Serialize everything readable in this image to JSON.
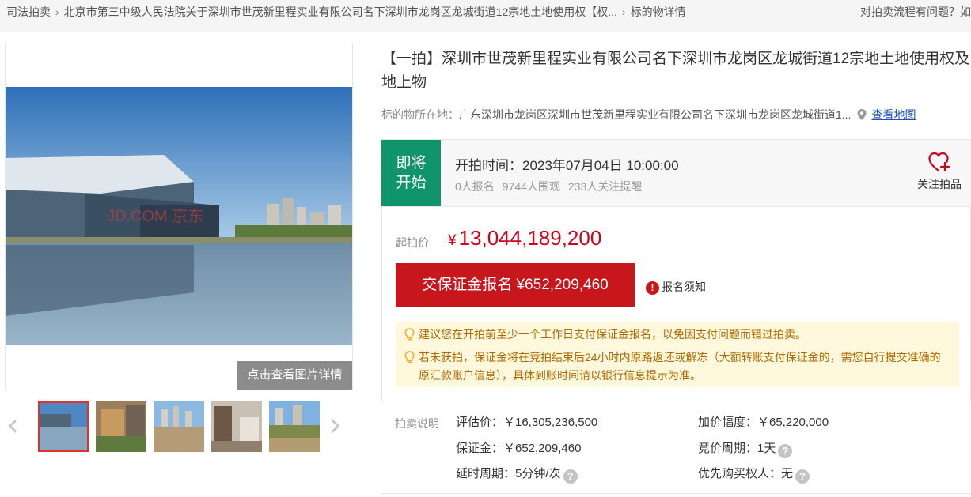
{
  "breadcrumb": {
    "items": [
      "司法拍卖",
      "北京市第三中级人民法院关于深圳市世茂新里程实业有限公司名下深圳市龙岗区龙城街道12宗地土地使用权【权...",
      "标的物详情"
    ],
    "help": "对拍卖流程有问题？如"
  },
  "gallery": {
    "watermark": "JD.COM 京东",
    "detail_button": "点击查看图片详情",
    "prev_icon": "chevron-left-icon",
    "next_icon": "chevron-right-icon",
    "thumbnail_count": 5,
    "active_thumbnail": 1
  },
  "item": {
    "title": "【一拍】深圳市世茂新里程实业有限公司名下深圳市龙岗区龙城街道12宗地土地使用权及地上物",
    "location_label": "标的物所在地：",
    "location_value": "广东深圳市龙岗区深圳市世茂新里程实业有限公司名下深圳市龙岗区龙城街道1...",
    "map_link": "查看地图"
  },
  "status": {
    "badge_line1": "即将",
    "badge_line2": "开始",
    "start_time": "开拍时间：2023年07月04日 10:00:00",
    "signups": "0人报名",
    "watchers": "9744人围观",
    "reminders": "233人关注提醒",
    "follow_label": "关注拍品",
    "badge_color": "#10946a"
  },
  "pricing": {
    "start_label": "起拍价",
    "currency": "¥",
    "start_price": "13,044,189,200",
    "deposit_button": "交保证金报名 ¥652,209,460",
    "notice_link": "报名须知",
    "accent_color": "#c8161d"
  },
  "tips": [
    "建议您在开拍前至少一个工作日支付保证金报名，以免因支付问题而错过拍卖。",
    "若未获拍，保证金将在竞拍结束后24小时内原路返还或解冻（大额转账支付保证金的，需您自行提交准确的原汇款账户信息），具体到账时间请以银行信息提示为准。"
  ],
  "auction_info": {
    "label": "拍卖说明",
    "appraisal": "评估价：￥16,305,236,500",
    "increment": "加价幅度：￥65,220,000",
    "deposit": "保证金：￥652,209,460",
    "cycle": "竞价周期：1天",
    "extension": "延时周期：5分钟/次",
    "priority": "优先购买权人：无"
  }
}
